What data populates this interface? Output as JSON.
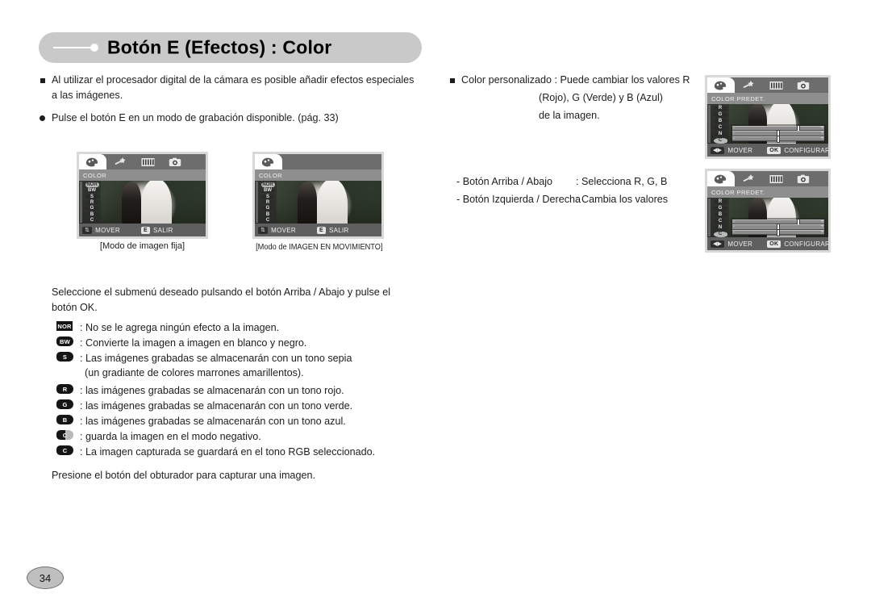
{
  "page": {
    "number": "34",
    "title": "Botón E (Efectos) : Color"
  },
  "left_column": {
    "bullets": [
      {
        "marker": "square",
        "lines": [
          "Al utilizar el procesador digital de la cámara es posible añadir efectos especiales",
          "a las imágenes."
        ]
      },
      {
        "marker": "round",
        "lines": [
          "Pulse el botón E en un modo de grabación disponible. (pág. 33)"
        ]
      }
    ],
    "instruction": [
      "Seleccione el submenú deseado pulsando el botón Arriba / Abajo y pulse el",
      "botón OK."
    ],
    "legend": [
      {
        "icon": "NOR",
        "icon_style": "box",
        "text": ": No se le agrega ningún efecto a la imagen."
      },
      {
        "icon": "BW",
        "icon_style": "pill",
        "text": ": Convierte la imagen a imagen en blanco y negro."
      },
      {
        "icon": "S",
        "icon_style": "pill",
        "text": ": Las imágenes grabadas se almacenarán con un tono sepia"
      },
      {
        "icon": "",
        "icon_style": "none",
        "text": "(un gradiante de colores marrones amarillentos)."
      },
      {
        "icon": "R",
        "icon_style": "pill",
        "text": ": las imágenes grabadas se almacenarán con un tono rojo."
      },
      {
        "icon": "G",
        "icon_style": "pill",
        "text": ": las imágenes grabadas se almacenarán con un tono verde."
      },
      {
        "icon": "B",
        "icon_style": "pill",
        "text": ": las imágenes grabadas se almacenarán con un tono azul."
      },
      {
        "icon": "C",
        "icon_style": "half",
        "text": ": guarda la imagen en el modo negativo."
      },
      {
        "icon": "C",
        "icon_style": "pill",
        "text": ": La imagen capturada se guardará en el tono RGB seleccionado."
      }
    ],
    "footer": "Presione el botón del obturador para capturar una imagen."
  },
  "right_column": {
    "bullet": {
      "marker": "square",
      "lines": [
        "Color personalizado : Puede cambiar los valores R",
        "(Rojo), G (Verde) y B (Azul)",
        "de la imagen."
      ]
    },
    "key_hints": [
      {
        "key": "- Botón Arriba / Abajo",
        "action": ": Selecciona R, G, B"
      },
      {
        "key": "- Botón Izquierda / Derecha",
        "action": ": Cambia los valores"
      }
    ]
  },
  "lcd_screens": [
    {
      "id": "still-image-mode",
      "menu_title": "COLOR",
      "tabs": [
        "color-palette-icon",
        "wand-icon",
        "film-strip-icon",
        "camera-icon"
      ],
      "active_tab_index": 0,
      "options": [
        "NOR",
        "BW",
        "S",
        "R",
        "G",
        "B",
        "C"
      ],
      "selected_option_index": 0,
      "bottom_bar": [
        {
          "key": "⇅",
          "label": "MOVER",
          "style": "dark"
        },
        {
          "key": "E",
          "label": "SALIR",
          "style": "light"
        }
      ],
      "caption": "[Modo de imagen fija]",
      "has_rgb_sliders": false
    },
    {
      "id": "movie-image-mode",
      "menu_title": "COLOR",
      "tabs": [
        "color-palette-icon"
      ],
      "active_tab_index": 0,
      "options": [
        "NOR",
        "BW",
        "S",
        "R",
        "G",
        "B",
        "C"
      ],
      "selected_option_index": 0,
      "bottom_bar": [
        {
          "key": "⇅",
          "label": "MOVER",
          "style": "dark"
        },
        {
          "key": "E",
          "label": "SALIR",
          "style": "light"
        }
      ],
      "caption": "[Modo de IMAGEN EN MOVIMIENTO]",
      "has_rgb_sliders": false
    },
    {
      "id": "custom-color-still",
      "menu_title": "COLOR PREDET.",
      "tabs": [
        "color-palette-icon",
        "wand-icon",
        "film-strip-icon",
        "camera-icon"
      ],
      "active_tab_index": 0,
      "options": [
        "R",
        "G",
        "B",
        "C",
        "N",
        "C"
      ],
      "selected_option_index": 5,
      "bottom_bar": [
        {
          "key": "◀▶",
          "label": "MOVER",
          "style": "dark"
        },
        {
          "key": "OK",
          "label": "CONFIGURAR",
          "style": "light"
        }
      ],
      "caption": "",
      "has_rgb_sliders": true,
      "rgb_values": [
        70,
        48,
        48
      ]
    },
    {
      "id": "custom-color-movie",
      "menu_title": "COLOR PREDET.",
      "tabs": [
        "color-palette-icon",
        "wand-icon",
        "film-strip-icon",
        "camera-icon"
      ],
      "active_tab_index": 0,
      "options": [
        "R",
        "G",
        "B",
        "C",
        "N",
        "C"
      ],
      "selected_option_index": 5,
      "bottom_bar": [
        {
          "key": "◀▶",
          "label": "MOVER",
          "style": "dark"
        },
        {
          "key": "OK",
          "label": "CONFIGURAR",
          "style": "light"
        }
      ],
      "caption": "",
      "has_rgb_sliders": true,
      "rgb_values": [
        70,
        48,
        48
      ]
    }
  ],
  "colors": {
    "banner": "#c9c9c9",
    "text": "#1d1d1d",
    "lcd_frame": "#d8d8d8",
    "page_badge": "#bfbfbf"
  }
}
